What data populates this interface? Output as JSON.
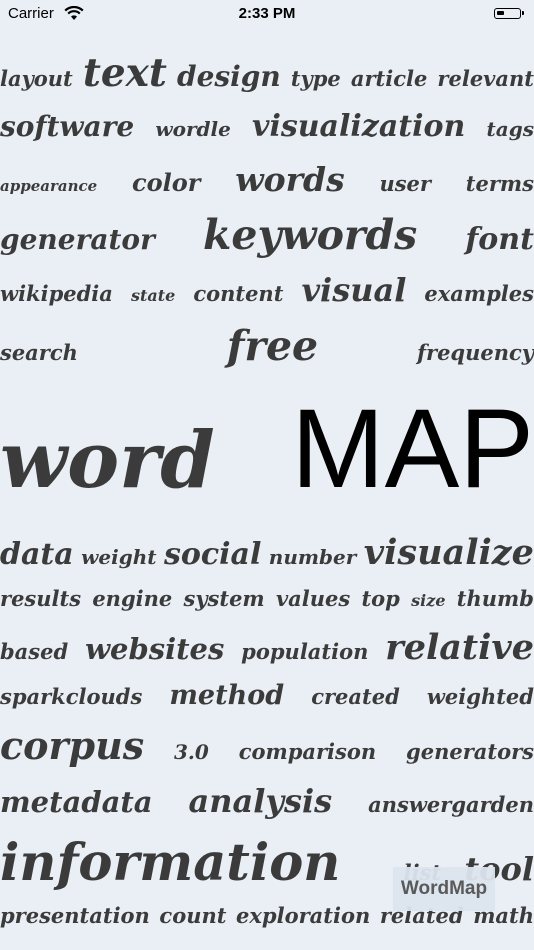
{
  "status_bar": {
    "carrier": "Carrier",
    "time": "2:33 PM",
    "battery_level_percent": 35
  },
  "word_cloud": {
    "rows": [
      [
        {
          "t": "layout"
        },
        {
          "t": "text"
        },
        {
          "t": "design"
        },
        {
          "t": "type"
        },
        {
          "t": "article"
        },
        {
          "t": "relevant"
        }
      ],
      [
        {
          "t": "software"
        },
        {
          "t": "wordle"
        },
        {
          "t": "visualization"
        },
        {
          "t": "tags"
        }
      ],
      [
        {
          "t": "appearance"
        },
        {
          "t": "color"
        },
        {
          "t": "words"
        },
        {
          "t": "user"
        },
        {
          "t": "terms"
        }
      ],
      [
        {
          "t": "generator"
        },
        {
          "t": "keywords"
        },
        {
          "t": "font"
        }
      ],
      [
        {
          "t": "wikipedia"
        },
        {
          "t": "state"
        },
        {
          "t": "content"
        },
        {
          "t": "visual"
        },
        {
          "t": "examples"
        }
      ],
      [
        {
          "t": "search"
        },
        {
          "t": "free"
        },
        {
          "t": "frequency"
        }
      ],
      [
        {
          "t": "word"
        },
        {
          "t": "MAP"
        }
      ],
      [
        {
          "t": "data"
        },
        {
          "t": "weight"
        },
        {
          "t": "social"
        },
        {
          "t": "number"
        },
        {
          "t": "visualize"
        }
      ],
      [
        {
          "t": "results"
        },
        {
          "t": "engine"
        },
        {
          "t": "system"
        },
        {
          "t": "values"
        },
        {
          "t": "top"
        },
        {
          "t": "size"
        },
        {
          "t": "thumb"
        }
      ],
      [
        {
          "t": "based"
        },
        {
          "t": "websites"
        },
        {
          "t": "population"
        },
        {
          "t": "relative"
        }
      ],
      [
        {
          "t": "sparkclouds"
        },
        {
          "t": "method"
        },
        {
          "t": "created"
        },
        {
          "t": "weighted"
        }
      ],
      [
        {
          "t": "corpus"
        },
        {
          "t": "3.0"
        },
        {
          "t": "comparison"
        },
        {
          "t": "generators"
        }
      ],
      [
        {
          "t": "metadata"
        },
        {
          "t": "analysis"
        },
        {
          "t": "answergarden"
        }
      ],
      [
        {
          "t": "information"
        },
        {
          "t": "list"
        },
        {
          "t": "tool"
        }
      ],
      [
        {
          "t": "presentation"
        },
        {
          "t": "count"
        },
        {
          "t": "exploration"
        },
        {
          "t": "related"
        },
        {
          "t": "math"
        }
      ]
    ]
  },
  "badge": {
    "label": "WordMap"
  }
}
